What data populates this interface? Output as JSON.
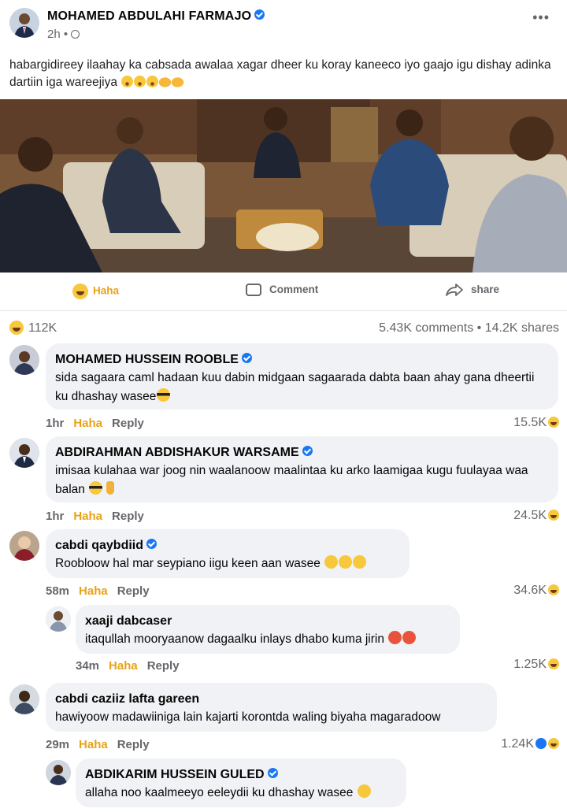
{
  "post": {
    "author": "MOHAMED ABDULAHI FARMAJO",
    "time": "2h",
    "more": "•••",
    "text": "habargidireey ilaahay ka cabsada awalaa xagar dheer ku koray kaneeco iyo gaajo igu dishay adinka dartiin iga wareejiya"
  },
  "actions": {
    "haha": "Haha",
    "comment": "Comment",
    "share": "share"
  },
  "stats": {
    "reactions": "112K",
    "comments_shares": "5.43K comments • 14.2K shares"
  },
  "comments": [
    {
      "name": "MOHAMED HUSSEIN ROOBLE",
      "verified": true,
      "text": "sida sagaara caml hadaan kuu dabin  midgaan sagaarada dabta baan ahay gana dheertii ku dhashay wasee",
      "time": "1hr",
      "haha": "Haha",
      "reply": "Reply",
      "count": "15.5K"
    },
    {
      "name": "ABDIRAHMAN ABDISHAKUR WARSAME",
      "verified": true,
      "text": "imisaa kulahaa war joog nin waalanoow maalintaa ku arko laamigaa kugu fuulayaa waa balan",
      "time": "1hr",
      "haha": "Haha",
      "reply": "Reply",
      "count": "24.5K"
    },
    {
      "name": "cabdi qaybdiid",
      "verified": true,
      "text": "Roobloow hal mar  seypiano iigu keen aan wasee",
      "time": "58m",
      "haha": "Haha",
      "reply": "Reply",
      "count": "34.6K"
    },
    {
      "name": "xaaji dabcaser",
      "verified": false,
      "text": "itaqullah mooryaanow dagaalku inlays dhabo kuma jirin",
      "time": "34m",
      "haha": "Haha",
      "reply": "Reply",
      "count": "1.25K"
    },
    {
      "name": "cabdi caziiz lafta gareen",
      "verified": false,
      "text": "hawiyoow madawiiniga lain kajarti korontda waling biyaha  magaradoow",
      "time": "29m",
      "haha": "Haha",
      "reply": "Reply",
      "count": "1.24K"
    },
    {
      "name": "ABDIKARIM HUSSEIN GULED",
      "verified": true,
      "text": "allaha noo kaalmeeyo eeleydii ku dhashay wasee"
    }
  ]
}
